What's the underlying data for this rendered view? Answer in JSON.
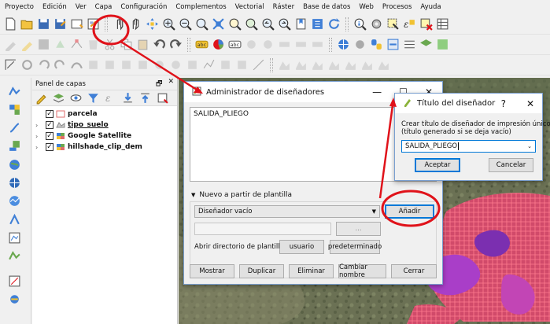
{
  "menu": [
    "Proyecto",
    "Edición",
    "Ver",
    "Capa",
    "Configuración",
    "Complementos",
    "Vectorial",
    "Ráster",
    "Base de datos",
    "Web",
    "Procesos",
    "Ayuda"
  ],
  "layer_panel": {
    "title": "Panel de capas",
    "float_glyph": "🗗",
    "close_glyph": "✕",
    "layers": [
      {
        "name": "parcela",
        "expandable": false
      },
      {
        "name": "tipo_suelo",
        "expandable": true
      },
      {
        "name": "Google Satellite",
        "expandable": true
      },
      {
        "name": "hillshade_clip_dem",
        "expandable": true
      }
    ]
  },
  "manager_dialog": {
    "title": "Administrador de diseñadores",
    "minimize_glyph": "—",
    "maximize_glyph": "☐",
    "close_glyph": "✕",
    "layouts": [
      "SALIDA_PLIEGO"
    ],
    "template_section": "Nuevo a partir de plantilla",
    "template_select": "Diseñador vacío",
    "browse_button": "...",
    "templates_dir_label": "Abrir directorio de plantillas",
    "user_button": "usuario",
    "default_button": "predeterminado",
    "add_button": "Añadir",
    "show_button": "Mostrar",
    "duplicate_button": "Duplicar",
    "delete_button": "Eliminar",
    "rename_button": "Cambiar nombre",
    "close_button": "Cerrar"
  },
  "title_dialog": {
    "title": "Título del diseñador",
    "help_glyph": "?",
    "close_glyph": "✕",
    "prompt_line1": "Crear título de diseñador de impresión único",
    "prompt_line2": "(título generado si se deja vacío)",
    "input_value": "SALIDA_PLIEGO",
    "accept_button": "Aceptar",
    "cancel_button": "Cancelar"
  },
  "colors": {
    "annotation": "#e0121a",
    "map_hatch": "#e2485e",
    "map_purple": "#a93ec8",
    "dialog_border": "#7a9fd0",
    "focus_blue": "#0078d7"
  }
}
